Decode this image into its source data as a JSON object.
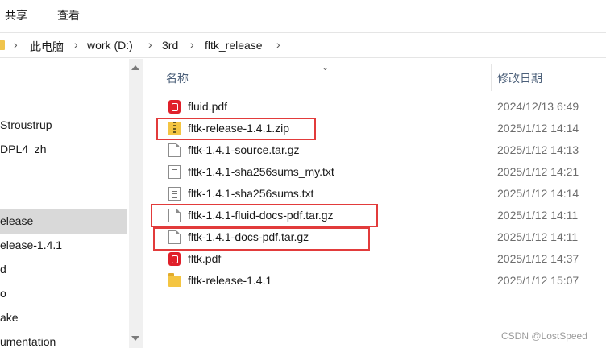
{
  "menubar": {
    "share": "共享",
    "view": "查看"
  },
  "address": {
    "crumbs": [
      "此电脑",
      "work (D:)",
      "3rd",
      "fltk_release"
    ],
    "separator": "›"
  },
  "nav": {
    "items": [
      {
        "label": "Stroustrup"
      },
      {
        "label": "DPL4_zh"
      },
      {
        "label": "elease"
      },
      {
        "label": "elease-1.4.1"
      },
      {
        "label": "d"
      },
      {
        "label": "o"
      },
      {
        "label": "ake"
      },
      {
        "label": "umentation"
      }
    ]
  },
  "columns": {
    "name": "名称",
    "modified": "修改日期"
  },
  "files": [
    {
      "name": "fluid.pdf",
      "date": "2024/12/13 6:49",
      "icon": "pdf-icon"
    },
    {
      "name": "fltk-release-1.4.1.zip",
      "date": "2025/1/12 14:14",
      "icon": "zip-icon"
    },
    {
      "name": "fltk-1.4.1-source.tar.gz",
      "date": "2025/1/12 14:13",
      "icon": "file-icon"
    },
    {
      "name": "fltk-1.4.1-sha256sums_my.txt",
      "date": "2025/1/12 14:21",
      "icon": "text-file-icon"
    },
    {
      "name": "fltk-1.4.1-sha256sums.txt",
      "date": "2025/1/12 14:14",
      "icon": "text-file-icon"
    },
    {
      "name": "fltk-1.4.1-fluid-docs-pdf.tar.gz",
      "date": "2025/1/12 14:11",
      "icon": "file-icon"
    },
    {
      "name": "fltk-1.4.1-docs-pdf.tar.gz",
      "date": "2025/1/12 14:11",
      "icon": "file-icon"
    },
    {
      "name": "fltk.pdf",
      "date": "2025/1/12 14:37",
      "icon": "pdf-icon"
    },
    {
      "name": "fltk-release-1.4.1",
      "date": "2025/1/12 15:07",
      "icon": "folder-icon"
    }
  ],
  "colors": {
    "highlight": "#e23b3b",
    "header_text": "#4c607a",
    "selected_nav": "#d9d9d9"
  },
  "watermark": "CSDN @LostSpeed"
}
